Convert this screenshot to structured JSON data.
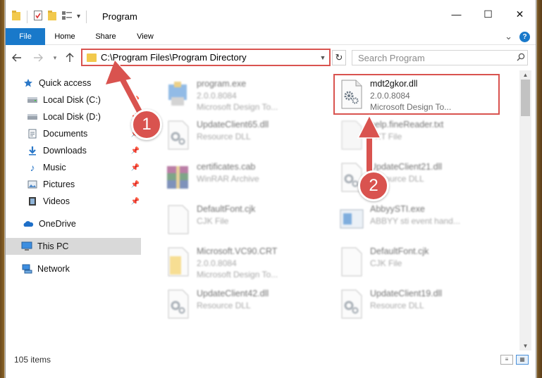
{
  "window": {
    "title": "Program",
    "qat_dropdown": "▾",
    "controls": {
      "minimize": "—",
      "maximize": "☐",
      "close": "✕"
    }
  },
  "ribbon": {
    "tabs": [
      "File",
      "Home",
      "Share",
      "View"
    ],
    "expand_glyph": "⌄",
    "help": "?"
  },
  "navigation": {
    "address": "C:\\Program Files\\Program Directory",
    "search_placeholder": "Search Program"
  },
  "sidebar": {
    "items": [
      {
        "label": "Quick access",
        "icon": "star-icon",
        "pinned": false
      },
      {
        "label": "Local Disk (C:)",
        "icon": "drive-icon",
        "pinned": true
      },
      {
        "label": "Local Disk (D:)",
        "icon": "drive-icon",
        "pinned": true
      },
      {
        "label": "Documents",
        "icon": "documents-icon",
        "pinned": true
      },
      {
        "label": "Downloads",
        "icon": "download-icon",
        "pinned": true
      },
      {
        "label": "Music",
        "icon": "music-icon",
        "pinned": true
      },
      {
        "label": "Pictures",
        "icon": "pictures-icon",
        "pinned": true
      },
      {
        "label": "Videos",
        "icon": "videos-icon",
        "pinned": true
      },
      {
        "label": "OneDrive",
        "icon": "onedrive-icon",
        "pinned": false
      },
      {
        "label": "This PC",
        "icon": "computer-icon",
        "pinned": false,
        "selected": true
      },
      {
        "label": "Network",
        "icon": "network-icon",
        "pinned": false
      }
    ]
  },
  "files": [
    {
      "name": "program.exe",
      "line1": "2.0.0.8084",
      "line2": "Microsoft Design To...",
      "icon": "installer-icon",
      "blurred": true
    },
    {
      "name": "mdt2gkor.dll",
      "line1": "2.0.0.8084",
      "line2": "Microsoft Design To...",
      "icon": "gear-file-icon",
      "blurred": false,
      "highlighted": true
    },
    {
      "name": "UpdateClient65.dll",
      "line1": "Resource DLL",
      "line2": "",
      "icon": "gear-file-icon",
      "blurred": true
    },
    {
      "name": "help.fineReader.txt",
      "line1": "TXT File",
      "line2": "",
      "icon": "text-file-icon",
      "blurred": true
    },
    {
      "name": "certificates.cab",
      "line1": "WinRAR Archive",
      "line2": "",
      "icon": "winrar-icon",
      "blurred": true
    },
    {
      "name": "UpdateClient21.dll",
      "line1": "Resource DLL",
      "line2": "",
      "icon": "gear-file-icon",
      "blurred": true
    },
    {
      "name": "DefaultFont.cjk",
      "line1": "CJK File",
      "line2": "",
      "icon": "blank-file-icon",
      "blurred": true
    },
    {
      "name": "AbbyySTI.exe",
      "line1": "ABBYY sti event hand...",
      "line2": "",
      "icon": "app-window-icon",
      "blurred": true
    },
    {
      "name": "Microsoft.VC90.CRT",
      "line1": "2.0.0.8084",
      "line2": "Microsoft Design To...",
      "icon": "folder-file-icon",
      "blurred": true
    },
    {
      "name": "DefaultFont.cjk",
      "line1": "CJK File",
      "line2": "",
      "icon": "blank-file-icon",
      "blurred": true
    },
    {
      "name": "UpdateClient42.dll",
      "line1": "Resource DLL",
      "line2": "",
      "icon": "gear-file-icon",
      "blurred": true
    },
    {
      "name": "UpdateClient19.dll",
      "line1": "Resource DLL",
      "line2": "",
      "icon": "gear-file-icon",
      "blurred": true
    }
  ],
  "status": {
    "item_count": "105 items"
  },
  "annotations": {
    "step1": "1",
    "step2": "2"
  },
  "colors": {
    "accent": "#1979ca",
    "highlight": "#d9534f",
    "folder": "#f2c94c"
  }
}
